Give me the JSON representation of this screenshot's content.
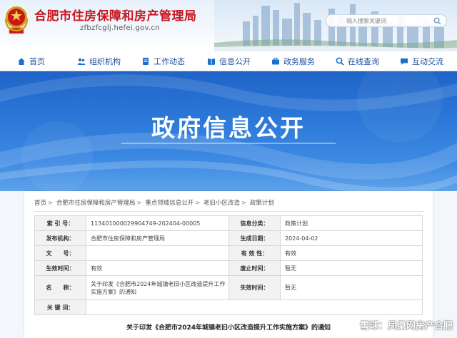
{
  "header": {
    "site_title": "合肥市住房保障和房产管理局",
    "site_domain": "zfbzfcglj.hefei.gov.cn",
    "search_placeholder": "输入搜索关键词"
  },
  "nav": {
    "items": [
      {
        "label": "首页",
        "icon": "home-icon"
      },
      {
        "label": "组织机构",
        "icon": "people-icon"
      },
      {
        "label": "工作动态",
        "icon": "document-icon"
      },
      {
        "label": "信息公开",
        "icon": "book-icon"
      },
      {
        "label": "政务服务",
        "icon": "briefcase-icon"
      },
      {
        "label": "在线查询",
        "icon": "search-icon"
      },
      {
        "label": "互动交流",
        "icon": "chat-icon"
      }
    ]
  },
  "banner": {
    "title": "政府信息公开"
  },
  "breadcrumb": [
    "首页",
    "合肥市住房保障和房产管理局",
    "重点领域信息公开",
    "老旧小区改造",
    "政策计划"
  ],
  "info": {
    "index_no_label": "索 引 号：",
    "index_no": "11340100002990474​9-202404-00005",
    "category_label": "信息分类：",
    "category": "政策计划",
    "publisher_label": "发布机构：",
    "publisher": "合肥市住房保障和房产管理局",
    "date_label": "生成日期：",
    "date": "2024-04-02",
    "doc_no_label": "文　　号：",
    "doc_no": "",
    "validity_label": "有 效 性：",
    "validity": "有效",
    "effective_label": "生效时间：",
    "effective": "有效",
    "abolish_label": "废止时间：",
    "abolish": "暂无",
    "name_label": "名　　称：",
    "name": "关于印发《合肥市2024年城镇老旧小区改造提升工作实施方案》的通知",
    "expire_label": "失效时间：",
    "expire": "暂无",
    "keywords_label": "关 键 词：",
    "keywords": ""
  },
  "doc_title": "关于印发《合肥市2024年城镇老旧小区改造提升工作实施方案》的通知",
  "watermark": "雪球：凤凰网房产合肥",
  "colors": {
    "brand_red": "#c8161d",
    "nav_blue": "#1c4f9c",
    "banner_blue": "#2b78d8"
  }
}
